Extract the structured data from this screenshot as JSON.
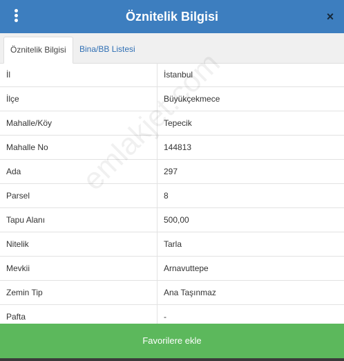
{
  "header": {
    "title": "Öznitelik Bilgisi",
    "close_glyph": "×"
  },
  "tabs": [
    {
      "label": "Öznitelik Bilgisi",
      "active": true
    },
    {
      "label": "Bina/BB Listesi",
      "active": false
    }
  ],
  "attributes": [
    {
      "key": "İl",
      "value": "İstanbul"
    },
    {
      "key": "İlçe",
      "value": "Büyükçekmece"
    },
    {
      "key": "Mahalle/Köy",
      "value": "Tepecik"
    },
    {
      "key": "Mahalle No",
      "value": "144813"
    },
    {
      "key": "Ada",
      "value": "297"
    },
    {
      "key": "Parsel",
      "value": "8"
    },
    {
      "key": "Tapu Alanı",
      "value": "500,00"
    },
    {
      "key": "Nitelik",
      "value": "Tarla"
    },
    {
      "key": "Mevkii",
      "value": "Arnavuttepe"
    },
    {
      "key": "Zemin Tip",
      "value": "Ana Taşınmaz"
    },
    {
      "key": "Pafta",
      "value": "-"
    }
  ],
  "watermark": "emlakjet.com",
  "favorite_button": {
    "label": "Favorilere ekle",
    "color": "#5cb85c"
  },
  "colors": {
    "header": "#3d7ebf",
    "tab_link": "#2f6fb4"
  }
}
